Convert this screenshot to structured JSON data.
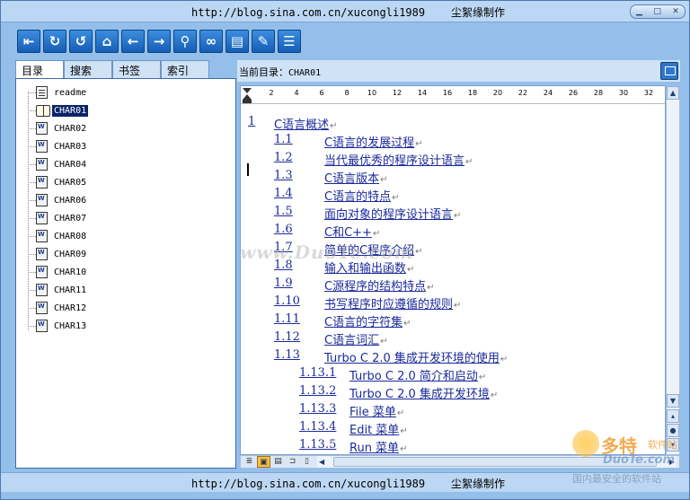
{
  "window": {
    "title": "http://blog.sina.com.cn/xucongli1989    尘絮缘制作",
    "controls": [
      "▁",
      "□",
      "✕"
    ]
  },
  "toolbar": {
    "buttons": [
      {
        "name": "sync-toc-icon",
        "glyph": "⇤"
      },
      {
        "name": "refresh-icon",
        "glyph": "↻"
      },
      {
        "name": "reload-icon",
        "glyph": "↺"
      },
      {
        "name": "home-icon",
        "glyph": "⌂"
      },
      {
        "name": "back-icon",
        "glyph": "←"
      },
      {
        "name": "forward-icon",
        "glyph": "→"
      },
      {
        "name": "search-icon",
        "glyph": "⚲"
      },
      {
        "name": "link-icon",
        "glyph": "∞"
      },
      {
        "name": "document-icon",
        "glyph": "▤"
      },
      {
        "name": "edit-icon",
        "glyph": "✎"
      },
      {
        "name": "notes-icon",
        "glyph": "☰"
      }
    ]
  },
  "tabs": [
    {
      "label": "目录",
      "width": 54
    },
    {
      "label": "搜索",
      "width": 54
    },
    {
      "label": "书签",
      "width": 54
    },
    {
      "label": "索引",
      "width": 54
    }
  ],
  "tree": {
    "items": [
      {
        "label": "readme",
        "icon": "doc"
      },
      {
        "label": "CHAR01",
        "icon": "book",
        "selected": true
      },
      {
        "label": "CHAR02",
        "icon": "word"
      },
      {
        "label": "CHAR03",
        "icon": "word"
      },
      {
        "label": "CHAR04",
        "icon": "word"
      },
      {
        "label": "CHAR05",
        "icon": "word"
      },
      {
        "label": "CHAR06",
        "icon": "word"
      },
      {
        "label": "CHAR07",
        "icon": "word"
      },
      {
        "label": "CHAR08",
        "icon": "word"
      },
      {
        "label": "CHAR09",
        "icon": "word"
      },
      {
        "label": "CHAR10",
        "icon": "word"
      },
      {
        "label": "CHAR11",
        "icon": "word"
      },
      {
        "label": "CHAR12",
        "icon": "word"
      },
      {
        "label": "CHAR13",
        "icon": "word"
      }
    ]
  },
  "path_bar": {
    "label": "当前目录：",
    "value": "CHAR01"
  },
  "ruler": {
    "ticks": [
      "2",
      "4",
      "6",
      "8",
      "10",
      "12",
      "14",
      "16",
      "18",
      "20",
      "22",
      "24",
      "26",
      "28",
      "30",
      "32"
    ]
  },
  "toc": [
    {
      "num": "1",
      "title": "C语言概述",
      "level": 0
    },
    {
      "num": "1.1",
      "title": "C语言的发展过程",
      "level": 1
    },
    {
      "num": "1.2",
      "title": "当代最优秀的程序设计语言",
      "level": 1
    },
    {
      "num": "1.3",
      "title": "C语言版本",
      "level": 1
    },
    {
      "num": "1.4",
      "title": "C语言的特点",
      "level": 1
    },
    {
      "num": "1.5",
      "title": "面向对象的程序设计语言",
      "level": 1
    },
    {
      "num": "1.6",
      "title": "C和C++",
      "level": 1
    },
    {
      "num": "1.7",
      "title": "简单的C程序介绍",
      "level": 1
    },
    {
      "num": "1.8",
      "title": "输入和输出函数",
      "level": 1
    },
    {
      "num": "1.9",
      "title": "C源程序的结构特点",
      "level": 1
    },
    {
      "num": "1.10",
      "title": "书写程序时应遵循的规则",
      "level": 1
    },
    {
      "num": "1.11",
      "title": "C语言的字符集",
      "level": 1
    },
    {
      "num": "1.12",
      "title": "C语言词汇",
      "level": 1
    },
    {
      "num": "1.13",
      "title": "Turbo C 2.0 集成开发环境的使用",
      "level": 1
    },
    {
      "num": "1.13.1",
      "title": "Turbo C 2.0 简介和启动",
      "level": 2
    },
    {
      "num": "1.13.2",
      "title": "Turbo C 2.0 集成开发环境",
      "level": 2
    },
    {
      "num": "1.13.3",
      "title": "File 菜单",
      "level": 2
    },
    {
      "num": "1.13.4",
      "title": "Edit 菜单",
      "level": 2
    },
    {
      "num": "1.13.5",
      "title": "Run 菜单",
      "level": 2
    }
  ],
  "paragraph_mark": "↵",
  "scrollbar": {
    "up": "▲",
    "down": "▼",
    "prev": "▴",
    "select": "●",
    "next": "▾"
  },
  "view_buttons": [
    "≣",
    "▣",
    "▤",
    "⊐",
    "▯"
  ],
  "hscroll": {
    "left": "◀",
    "right": "▶"
  },
  "watermarks": {
    "center": "www.DuoTe.com",
    "brand_big": "多特",
    "brand_small": "软件站",
    "brand_mid": "DuoTe.com",
    "brand_sub": "国内最安全的软件站"
  },
  "status": {
    "text": "http://blog.sina.com.cn/xucongli1989    尘絮缘制作"
  }
}
